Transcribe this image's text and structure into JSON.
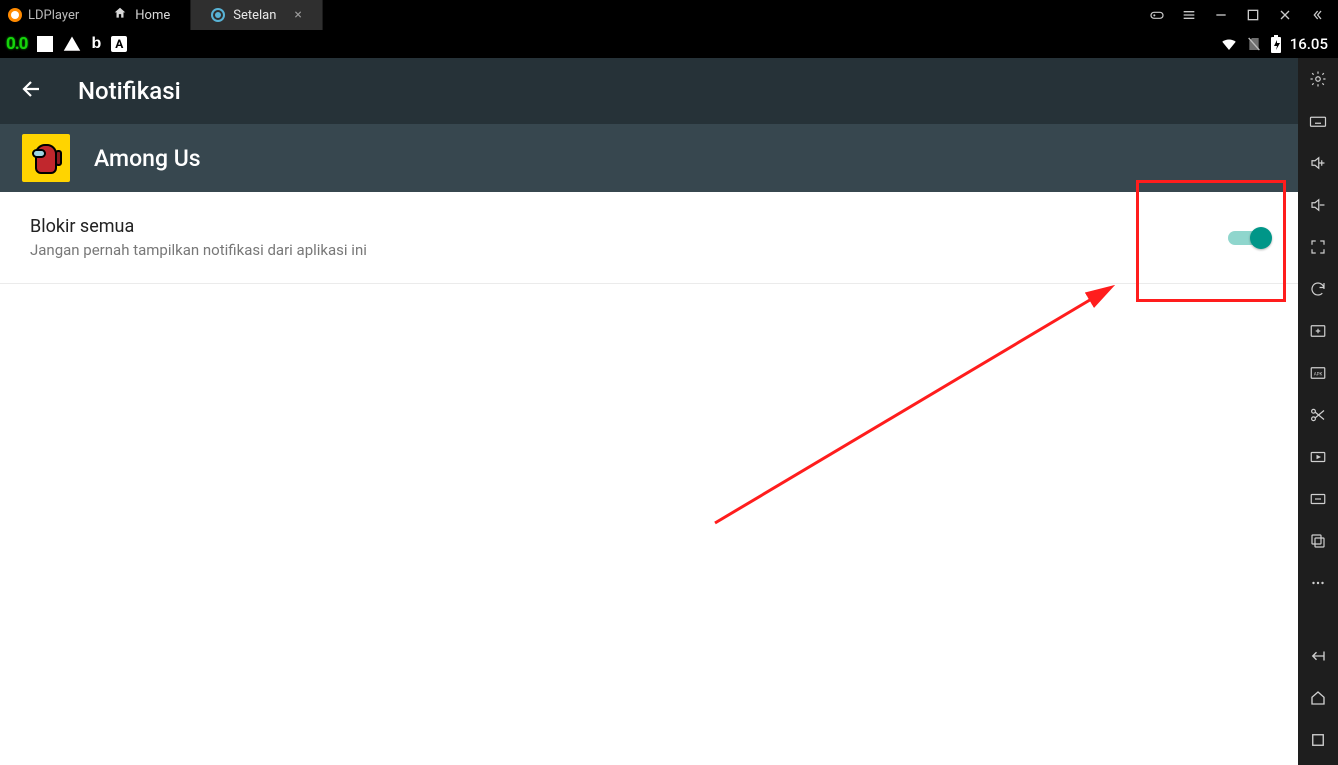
{
  "window": {
    "brand": "LDPlayer",
    "tabs": [
      {
        "label": "Home",
        "active": false
      },
      {
        "label": "Setelan",
        "active": true
      }
    ]
  },
  "statusbar": {
    "fps": "0.0",
    "time": "16.05"
  },
  "page": {
    "title": "Notifikasi",
    "app_name": "Among Us"
  },
  "setting": {
    "title": "Blokir semua",
    "subtitle": "Jangan pernah tampilkan notifikasi dari aplikasi ini",
    "enabled": true
  }
}
